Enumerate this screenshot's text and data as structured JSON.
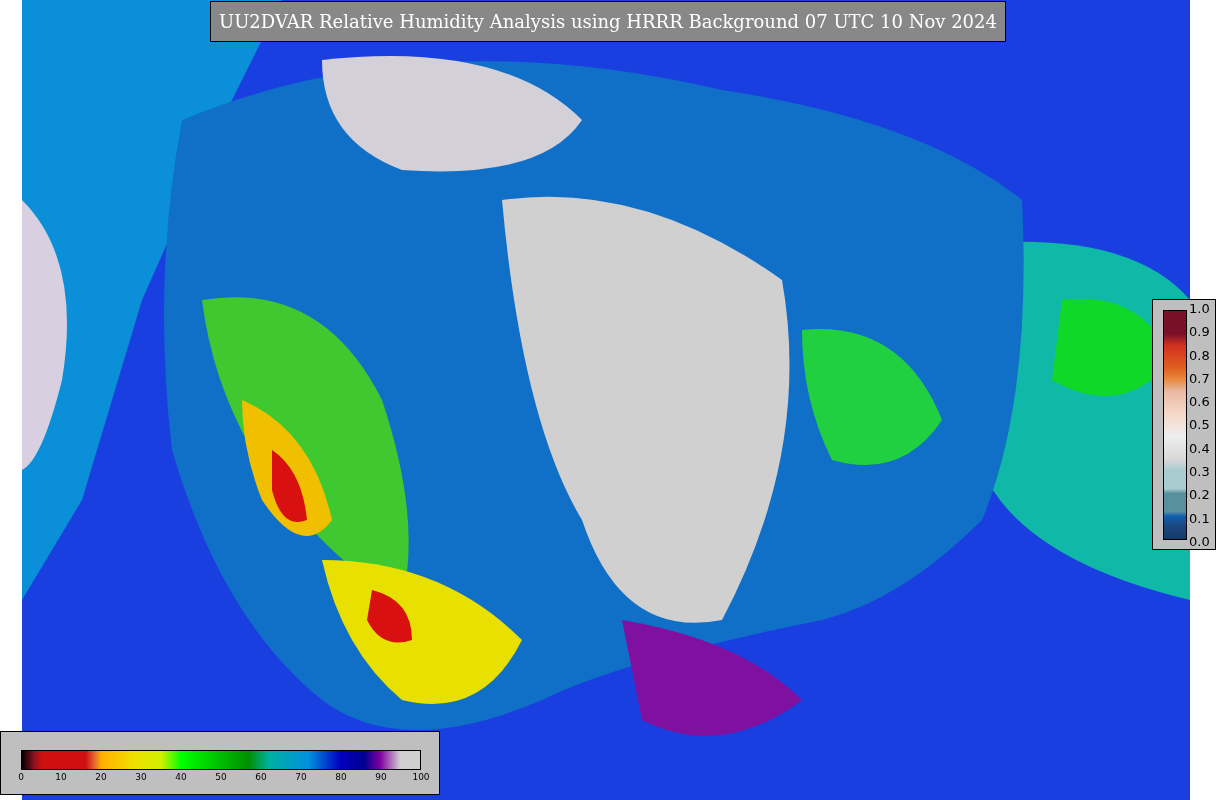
{
  "title": "UU2DVAR Relative Humidity Analysis using HRRR Background 07 UTC 10 Nov 2024",
  "humidity_colorbar": {
    "ticks": [
      "0",
      "10",
      "20",
      "30",
      "40",
      "50",
      "60",
      "70",
      "80",
      "90",
      "100"
    ]
  },
  "observation_colorbar": {
    "ticks": [
      "1.0",
      "0.9",
      "0.8",
      "0.7",
      "0.6",
      "0.5",
      "0.4",
      "0.3",
      "0.2",
      "0.1",
      "0.0"
    ]
  }
}
